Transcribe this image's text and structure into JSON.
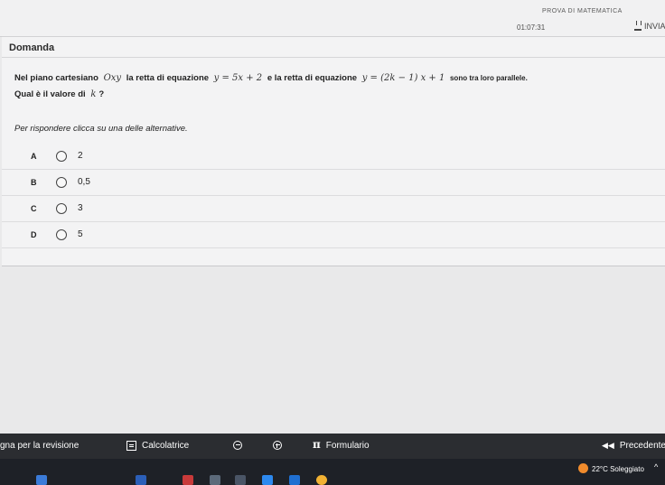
{
  "header": {
    "test_title": "PROVA DI MATEMATICA",
    "timer": "01:07:31",
    "send_label": "INVIA"
  },
  "question": {
    "section_title": "Domanda",
    "text_part1": "Nel piano cartesiano",
    "plane_symbol": "Oxy",
    "text_part2": "la retta di equazione",
    "eq1": "y = 5x + 2",
    "text_part3": "e la retta di equazione",
    "eq2": "y = (2k − 1) x + 1",
    "text_part4": "sono tra loro parallele.",
    "text_line2_prefix": "Qual è il valore di",
    "variable": "k",
    "text_line2_suffix": "?",
    "instructions": "Per rispondere clicca su una delle alternative."
  },
  "options": [
    {
      "letter": "A",
      "value": "2"
    },
    {
      "letter": "B",
      "value": "0,5"
    },
    {
      "letter": "C",
      "value": "3"
    },
    {
      "letter": "D",
      "value": "5"
    }
  ],
  "footer": {
    "review_label": "gna per la revisione",
    "calc_label": "Calcolatrice",
    "formula_label": "Formulario",
    "prev_label": "Precedente"
  },
  "taskbar": {
    "weather": "22°C Soleggiato"
  },
  "colors": {
    "footer_bg": "#2b2d31",
    "taskbar_bg": "#1e2127",
    "weather_icon": "#f08b2c"
  }
}
